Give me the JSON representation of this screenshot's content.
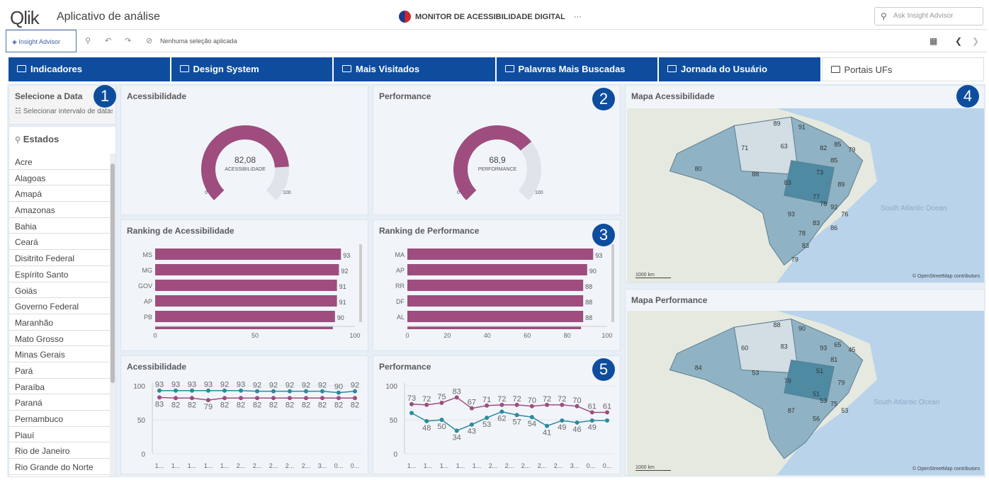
{
  "header": {
    "logo": "Qlik",
    "app_title": "Aplicativo de análise",
    "center_title": "MONITOR DE ACESSIBILIDADE DIGITAL",
    "more": "···",
    "ask_placeholder": "Ask Insight Advisor"
  },
  "toolbar": {
    "insight_advisor": "Insight Advisor",
    "selection_text": "Nenhuma seleção aplicada"
  },
  "tabs": [
    "Indicadores",
    "Design System",
    "Mais Visitados",
    "Palavras Mais Buscadas",
    "Jornada do Usuário",
    "Portais UFs"
  ],
  "filters": {
    "date_title": "Selecione a Data",
    "date_input": "Selecionar intervalo de datas",
    "states_title": "Estados",
    "states": [
      "Acre",
      "Alagoas",
      "Amapá",
      "Amazonas",
      "Bahia",
      "Ceará",
      "Disitrito Federal",
      "Espírito Santo",
      "Goiás",
      "Governo Federal",
      "Maranhão",
      "Mato Grosso",
      "Minas Gerais",
      "Pará",
      "Paraíba",
      "Paraná",
      "Pernambuco",
      "Piauí",
      "Rio de Janeiro",
      "Rio Grande do Norte"
    ]
  },
  "badges": [
    "1",
    "2",
    "3",
    "4",
    "5"
  ],
  "gauges": [
    {
      "title": "Acessibilidade",
      "value": "82,08",
      "label": "ACESSIBILIDADE",
      "fraction": 0.8208,
      "min": "0",
      "max": "100",
      "color": "#9e4d7e"
    },
    {
      "title": "Performance",
      "value": "68,9",
      "label": "PERFORMANCE",
      "fraction": 0.689,
      "min": "0",
      "max": "100",
      "color": "#9e4d7e"
    }
  ],
  "chart_data": [
    {
      "type": "bar",
      "title": "Ranking de Acessibilidade",
      "categories": [
        "MS",
        "MG",
        "GOV",
        "AP",
        "PB"
      ],
      "values": [
        93,
        92,
        91,
        91,
        90
      ],
      "xticks": [
        "0",
        "50",
        "100"
      ],
      "xlim": [
        0,
        100
      ]
    },
    {
      "type": "bar",
      "title": "Ranking de Performance",
      "categories": [
        "MA",
        "AP",
        "RR",
        "DF",
        "AL"
      ],
      "values": [
        93,
        90,
        88,
        88,
        88
      ],
      "xticks": [
        "0",
        "20",
        "40",
        "60",
        "80",
        "100"
      ],
      "xlim": [
        0,
        100
      ]
    },
    {
      "type": "line",
      "title": "Acessibilidade",
      "yticks": [
        "100",
        "50",
        "0"
      ],
      "ylim": [
        0,
        100
      ],
      "series": [
        {
          "values": [
            93,
            93,
            93,
            93,
            93,
            93,
            92,
            92,
            92,
            92,
            92,
            90,
            92
          ],
          "labels": [
            "93",
            "93",
            "93",
            "93",
            "92",
            "93",
            "92",
            "92",
            "92",
            "92",
            "92",
            "90",
            "92"
          ],
          "color": "#2b8a9e"
        },
        {
          "values": [
            83,
            82,
            82,
            79,
            82,
            82,
            82,
            82,
            82,
            82,
            82,
            82,
            82
          ],
          "labels": [
            "83",
            "82",
            "82",
            "79",
            "82",
            "82",
            "82",
            "82",
            "82",
            "82",
            "82",
            "82",
            "82"
          ],
          "color": "#9e4d7e"
        }
      ],
      "xlabels": [
        "1...",
        "1...",
        "1...",
        "1...",
        "1...",
        "2...",
        "2...",
        "2...",
        "2...",
        "2...",
        "3...",
        "0...",
        "0..."
      ]
    },
    {
      "type": "line",
      "title": "Performance",
      "yticks": [
        "100",
        "50",
        "0"
      ],
      "ylim": [
        0,
        100
      ],
      "series": [
        {
          "values": [
            73,
            72,
            75,
            83,
            67,
            71,
            72,
            72,
            70,
            72,
            72,
            70,
            61,
            61
          ],
          "labels": [
            "73",
            "72",
            "75",
            "83",
            "67",
            "71",
            "72",
            "72",
            "70",
            "72",
            "72",
            "70",
            "61",
            "61"
          ],
          "color": "#9e4d7e"
        },
        {
          "values": [
            60,
            48,
            50,
            34,
            43,
            53,
            62,
            57,
            54,
            41,
            49,
            46,
            49,
            49
          ],
          "labels": [
            "",
            "48",
            "50",
            "34",
            "43",
            "53",
            "62",
            "57",
            "54",
            "41",
            "49",
            "46",
            "49",
            ""
          ],
          "color": "#2b8a9e"
        }
      ],
      "xlabels": [
        "1...",
        "1...",
        "1...",
        "1...",
        "1...",
        "2...",
        "2...",
        "2...",
        "2...",
        "2...",
        "3...",
        "0...",
        "0..."
      ]
    }
  ],
  "maps": [
    {
      "title": "Mapa Acessibilidade",
      "ocean": "South Atlantic Ocean",
      "scale": "1000 km",
      "attribution": "© OpenStreetMap contributors",
      "labels": [
        "89",
        "91",
        "71",
        "63",
        "82",
        "85",
        "79",
        "85",
        "80",
        "88",
        "83",
        "73",
        "89",
        "77",
        "78",
        "92",
        "76",
        "93",
        "83",
        "86",
        "78",
        "83",
        "79"
      ]
    },
    {
      "title": "Mapa Performance",
      "ocean": "South Atlantic Ocean",
      "scale": "1000 km",
      "attribution": "© OpenStreetMap contributors",
      "labels": [
        "88",
        "90",
        "60",
        "83",
        "93",
        "65",
        "45",
        "81",
        "84",
        "53",
        "79",
        "51",
        "79",
        "51",
        "53",
        "75",
        "53",
        "87",
        "56"
      ]
    }
  ]
}
